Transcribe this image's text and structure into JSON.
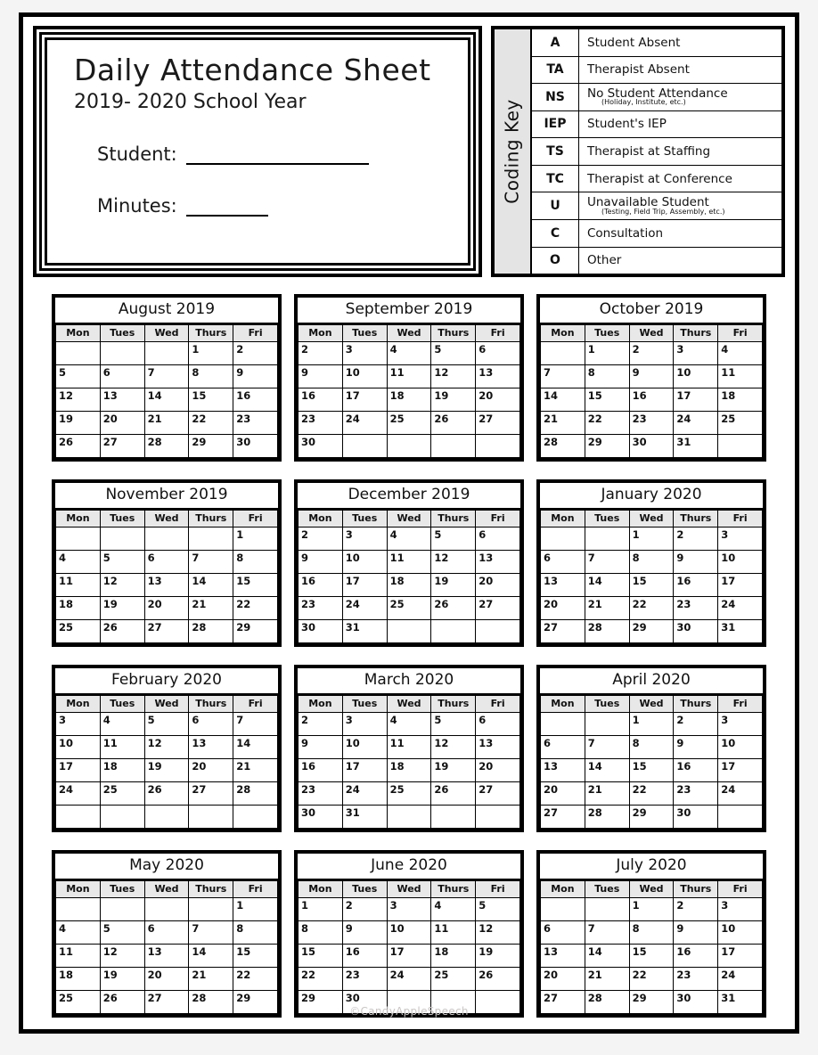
{
  "header": {
    "title": "Daily Attendance Sheet",
    "subtitle": "2019- 2020 School Year",
    "student_label": "Student:",
    "student_value": "",
    "minutes_label": "Minutes:",
    "minutes_value": ""
  },
  "coding_key": {
    "side_label": "Coding Key",
    "rows": [
      {
        "code": "A",
        "desc": "Student Absent",
        "sub": ""
      },
      {
        "code": "TA",
        "desc": "Therapist Absent",
        "sub": ""
      },
      {
        "code": "NS",
        "desc": "No Student Attendance",
        "sub": "(Holiday, Institute, etc.)"
      },
      {
        "code": "IEP",
        "desc": "Student's IEP",
        "sub": ""
      },
      {
        "code": "TS",
        "desc": "Therapist at Staffing",
        "sub": ""
      },
      {
        "code": "TC",
        "desc": "Therapist at Conference",
        "sub": ""
      },
      {
        "code": "U",
        "desc": "Unavailable Student",
        "sub": "(Testing, Field Trip, Assembly, etc.)"
      },
      {
        "code": "C",
        "desc": "Consultation",
        "sub": ""
      },
      {
        "code": "O",
        "desc": "Other",
        "sub": ""
      }
    ]
  },
  "calendar": {
    "weekday_headers": [
      "Mon",
      "Tues",
      "Wed",
      "Thurs",
      "Fri"
    ],
    "months": [
      {
        "title": "August 2019",
        "weeks": [
          [
            "",
            "",
            "",
            "1",
            "2"
          ],
          [
            "5",
            "6",
            "7",
            "8",
            "9"
          ],
          [
            "12",
            "13",
            "14",
            "15",
            "16"
          ],
          [
            "19",
            "20",
            "21",
            "22",
            "23"
          ],
          [
            "26",
            "27",
            "28",
            "29",
            "30"
          ]
        ]
      },
      {
        "title": "September 2019",
        "weeks": [
          [
            "2",
            "3",
            "4",
            "5",
            "6"
          ],
          [
            "9",
            "10",
            "11",
            "12",
            "13"
          ],
          [
            "16",
            "17",
            "18",
            "19",
            "20"
          ],
          [
            "23",
            "24",
            "25",
            "26",
            "27"
          ],
          [
            "30",
            "",
            "",
            "",
            ""
          ]
        ]
      },
      {
        "title": "October 2019",
        "weeks": [
          [
            "",
            "1",
            "2",
            "3",
            "4"
          ],
          [
            "7",
            "8",
            "9",
            "10",
            "11"
          ],
          [
            "14",
            "15",
            "16",
            "17",
            "18"
          ],
          [
            "21",
            "22",
            "23",
            "24",
            "25"
          ],
          [
            "28",
            "29",
            "30",
            "31",
            ""
          ]
        ]
      },
      {
        "title": "November 2019",
        "weeks": [
          [
            "",
            "",
            "",
            "",
            "1"
          ],
          [
            "4",
            "5",
            "6",
            "7",
            "8"
          ],
          [
            "11",
            "12",
            "13",
            "14",
            "15"
          ],
          [
            "18",
            "19",
            "20",
            "21",
            "22"
          ],
          [
            "25",
            "26",
            "27",
            "28",
            "29"
          ]
        ]
      },
      {
        "title": "December 2019",
        "weeks": [
          [
            "2",
            "3",
            "4",
            "5",
            "6"
          ],
          [
            "9",
            "10",
            "11",
            "12",
            "13"
          ],
          [
            "16",
            "17",
            "18",
            "19",
            "20"
          ],
          [
            "23",
            "24",
            "25",
            "26",
            "27"
          ],
          [
            "30",
            "31",
            "",
            "",
            ""
          ]
        ]
      },
      {
        "title": "January 2020",
        "weeks": [
          [
            "",
            "",
            "1",
            "2",
            "3"
          ],
          [
            "6",
            "7",
            "8",
            "9",
            "10"
          ],
          [
            "13",
            "14",
            "15",
            "16",
            "17"
          ],
          [
            "20",
            "21",
            "22",
            "23",
            "24"
          ],
          [
            "27",
            "28",
            "29",
            "30",
            "31"
          ]
        ]
      },
      {
        "title": "February 2020",
        "weeks": [
          [
            "3",
            "4",
            "5",
            "6",
            "7"
          ],
          [
            "10",
            "11",
            "12",
            "13",
            "14"
          ],
          [
            "17",
            "18",
            "19",
            "20",
            "21"
          ],
          [
            "24",
            "25",
            "26",
            "27",
            "28"
          ],
          [
            "",
            "",
            "",
            "",
            ""
          ]
        ]
      },
      {
        "title": "March 2020",
        "weeks": [
          [
            "2",
            "3",
            "4",
            "5",
            "6"
          ],
          [
            "9",
            "10",
            "11",
            "12",
            "13"
          ],
          [
            "16",
            "17",
            "18",
            "19",
            "20"
          ],
          [
            "23",
            "24",
            "25",
            "26",
            "27"
          ],
          [
            "30",
            "31",
            "",
            "",
            ""
          ]
        ]
      },
      {
        "title": "April 2020",
        "weeks": [
          [
            "",
            "",
            "1",
            "2",
            "3"
          ],
          [
            "6",
            "7",
            "8",
            "9",
            "10"
          ],
          [
            "13",
            "14",
            "15",
            "16",
            "17"
          ],
          [
            "20",
            "21",
            "22",
            "23",
            "24"
          ],
          [
            "27",
            "28",
            "29",
            "30",
            ""
          ]
        ]
      },
      {
        "title": "May 2020",
        "weeks": [
          [
            "",
            "",
            "",
            "",
            "1"
          ],
          [
            "4",
            "5",
            "6",
            "7",
            "8"
          ],
          [
            "11",
            "12",
            "13",
            "14",
            "15"
          ],
          [
            "18",
            "19",
            "20",
            "21",
            "22"
          ],
          [
            "25",
            "26",
            "27",
            "28",
            "29"
          ]
        ]
      },
      {
        "title": "June 2020",
        "weeks": [
          [
            "1",
            "2",
            "3",
            "4",
            "5"
          ],
          [
            "8",
            "9",
            "10",
            "11",
            "12"
          ],
          [
            "15",
            "16",
            "17",
            "18",
            "19"
          ],
          [
            "22",
            "23",
            "24",
            "25",
            "26"
          ],
          [
            "29",
            "30",
            "",
            "",
            ""
          ]
        ]
      },
      {
        "title": "July 2020",
        "weeks": [
          [
            "",
            "",
            "1",
            "2",
            "3"
          ],
          [
            "6",
            "7",
            "8",
            "9",
            "10"
          ],
          [
            "13",
            "14",
            "15",
            "16",
            "17"
          ],
          [
            "20",
            "21",
            "22",
            "23",
            "24"
          ],
          [
            "27",
            "28",
            "29",
            "30",
            "31"
          ]
        ]
      }
    ]
  },
  "footer": {
    "watermark": "©CandyAppleSpeech"
  }
}
